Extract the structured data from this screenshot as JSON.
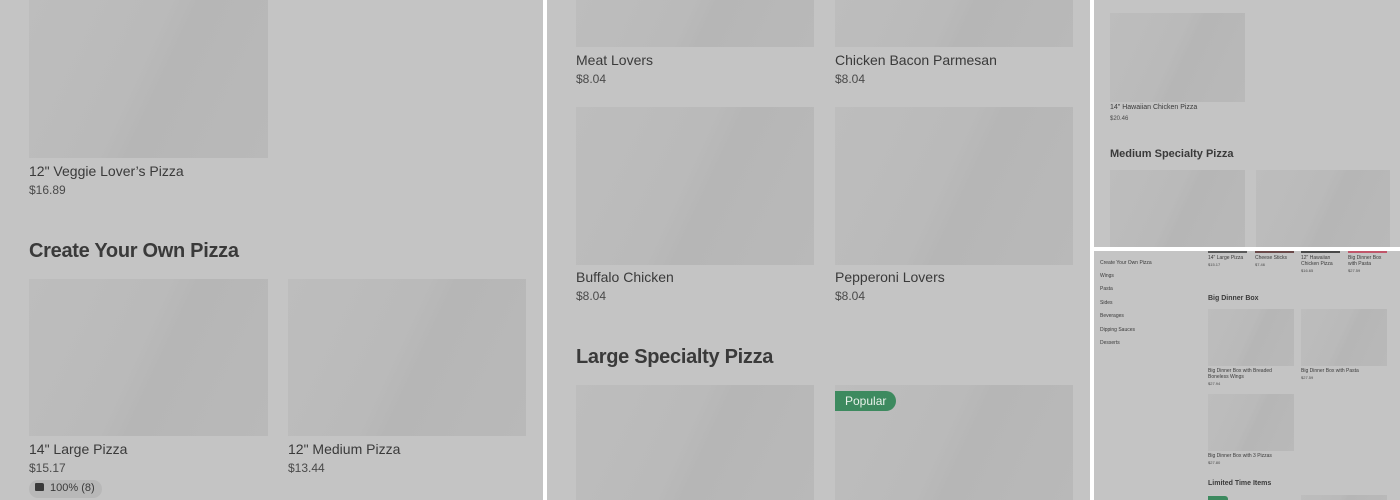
{
  "panel1": {
    "veggie": {
      "name": "12\" Veggie Lover’s Pizza",
      "price": "$16.89"
    },
    "create_heading": "Create Your Own Pizza",
    "large": {
      "name": "14\" Large Pizza",
      "price": "$15.17",
      "rating": "100% (8)"
    },
    "medium": {
      "name": "12\" Medium Pizza",
      "price": "$13.44"
    }
  },
  "panel2": {
    "meat": {
      "name": "Meat Lovers",
      "price": "$8.04"
    },
    "chicken_bacon": {
      "name": "Chicken Bacon Parmesan",
      "price": "$8.04"
    },
    "buffalo": {
      "name": "Buffalo Chicken",
      "price": "$8.04"
    },
    "pepperoni": {
      "name": "Pepperoni Lovers",
      "price": "$8.04"
    },
    "large_heading": "Large Specialty Pizza",
    "popular_badge": "Popular"
  },
  "panel3": {
    "hawaiian": {
      "name": "14\" Hawaiian Chicken Pizza",
      "price": "$20.46"
    },
    "medium_heading": "Medium Specialty Pizza"
  },
  "panel4": {
    "nav": [
      "Create Your Own Pizza",
      "Wings",
      "Pasta",
      "Sides",
      "Beverages",
      "Dipping Sauces",
      "Desserts"
    ],
    "top_items": [
      {
        "name": "14\" Large Pizza",
        "price": "$15.17"
      },
      {
        "name": "Cheese Sticks",
        "price": "$7.46"
      },
      {
        "name": "12\" Hawaiian Chicken Pizza",
        "price": "$16.65"
      },
      {
        "name": "Big Dinner Box with Pasta",
        "price": "$27.59"
      }
    ],
    "big_dinner_heading": "Big Dinner Box",
    "dinner_items": [
      {
        "name": "Big Dinner Box with Breaded Boneless Wings",
        "price": "$27.94"
      },
      {
        "name": "Big Dinner Box with Pasta",
        "price": "$27.59"
      },
      {
        "name": "Big Dinner Box with 3 Pizzas",
        "price": "$27.80"
      }
    ],
    "limited_heading": "Limited Time Items",
    "bar_colors": [
      "#5a5a5a",
      "#6b4a4a",
      "#4a4a4a",
      "#c0566a"
    ]
  }
}
